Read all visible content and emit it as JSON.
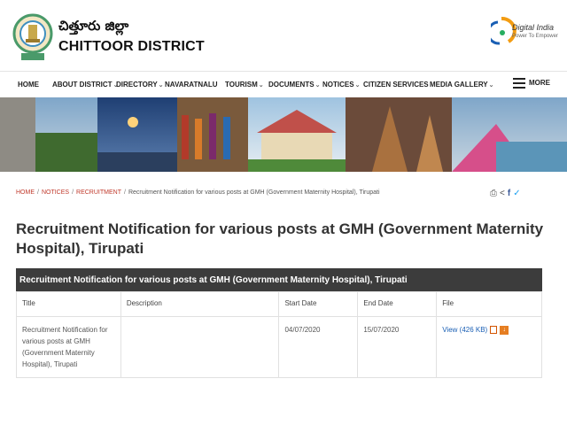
{
  "site": {
    "title_telugu": "చిత్తూరు జిల్లా",
    "title_english": "CHITTOOR DISTRICT",
    "digital_india_name": "Digital India",
    "digital_india_tagline": "Power To Empower"
  },
  "nav": {
    "items": [
      {
        "label": "HOME",
        "dropdown": false
      },
      {
        "label": "ABOUT DISTRICT",
        "dropdown": true
      },
      {
        "label": "DIRECTORY",
        "dropdown": true
      },
      {
        "label": "NAVARATNALU",
        "dropdown": false
      },
      {
        "label": "TOURISM",
        "dropdown": true
      },
      {
        "label": "DOCUMENTS",
        "dropdown": true
      },
      {
        "label": "NOTICES",
        "dropdown": true
      },
      {
        "label": "CITIZEN SERVICES",
        "dropdown": false
      },
      {
        "label": "MEDIA GALLERY",
        "dropdown": true
      }
    ],
    "more_label": "MORE",
    "chevron": "⌄"
  },
  "breadcrumb": {
    "home": "HOME",
    "notices": "NOTICES",
    "recruitment": "RECRUITMENT",
    "current": "Recruitment Notification for various posts at GMH (Government Maternity Hospital), Tirupati",
    "separator": "/"
  },
  "tools": {
    "print": "⎙",
    "share": "<",
    "facebook": "f",
    "twitter": "✓"
  },
  "page": {
    "title": "Recruitment Notification for various posts at GMH (Government Maternity Hospital), Tirupati"
  },
  "table": {
    "caption": "Recruitment Notification for various posts at GMH (Government Maternity Hospital), Tirupati",
    "headers": [
      "Title",
      "Description",
      "Start Date",
      "End Date",
      "File"
    ],
    "row": {
      "title": "Recruitment Notification for various posts at GMH (Government Maternity Hospital), Tirupati",
      "description": "",
      "start_date": "04/07/2020",
      "end_date": "15/07/2020",
      "file_label": "View (426 KB)",
      "download_glyph": "↓"
    }
  },
  "colors": {
    "nav_text": "#222222",
    "breadcrumb_link": "#c0392b",
    "table_caption_bg": "#3c3c3c",
    "file_link": "#1a5fb4",
    "download_icon": "#e67e22"
  }
}
